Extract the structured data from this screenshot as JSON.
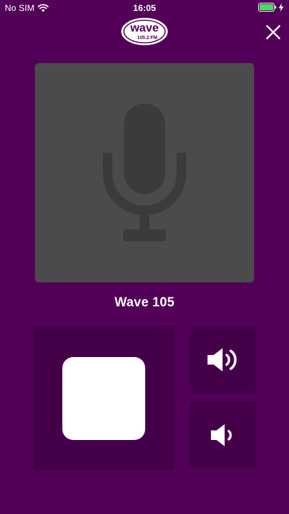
{
  "status_bar": {
    "carrier": "No SIM",
    "time": "16:05"
  },
  "header": {
    "logo_text": "wave",
    "logo_subtext": "105.2 FM"
  },
  "player": {
    "station_name": "Wave 105"
  },
  "colors": {
    "background": "#530058",
    "panel": "#45004a",
    "artwork": "#4b4b4b",
    "battery": "#4cd964"
  },
  "icons": {
    "wifi": "wifi-icon",
    "battery": "battery-icon",
    "charging": "charging-bolt-icon",
    "close": "close-icon",
    "microphone": "microphone-icon",
    "stop": "stop-icon",
    "volume_up": "volume-up-icon",
    "volume_down": "volume-down-icon"
  }
}
